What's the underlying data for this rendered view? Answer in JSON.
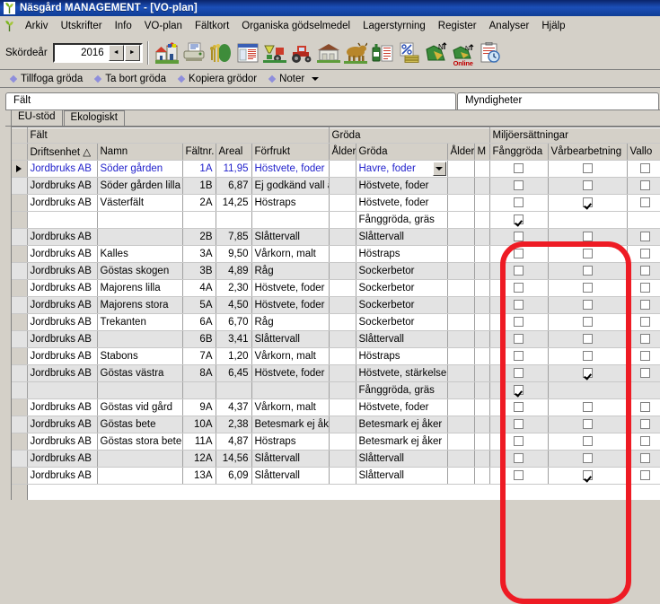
{
  "window": {
    "title": "Näsgård MANAGEMENT - [VO-plan]",
    "logo_icon": "leaf-icon"
  },
  "menu": {
    "items": [
      {
        "label": "Arkiv"
      },
      {
        "label": "Utskrifter"
      },
      {
        "label": "Info"
      },
      {
        "label": "VO-plan"
      },
      {
        "label": "Fältkort"
      },
      {
        "label": "Organiska gödselmedel"
      },
      {
        "label": "Lagerstyrning"
      },
      {
        "label": "Register"
      },
      {
        "label": "Analyser"
      },
      {
        "label": "Hjälp"
      }
    ]
  },
  "toolbar": {
    "year_label": "Skördeår",
    "year_value": "2016",
    "spin_down": "◄",
    "spin_up": "►",
    "online_label": "Online",
    "icons": [
      "farm-house-icon",
      "printer-icon",
      "crop-field-icon",
      "field-register-icon",
      "spreader-tractor-icon",
      "tractor-icon",
      "barn-icon",
      "cattle-icon",
      "fertilizer-bottle-icon",
      "percent-calc-icon",
      "nitrogen-map-icon",
      "nitrogen-map-online-icon",
      "clipboard-clock-icon"
    ]
  },
  "actionbar": {
    "items": [
      {
        "label": "Tillfoga gröda",
        "icon": "diamond-bullet-icon"
      },
      {
        "label": "Ta bort gröda",
        "icon": "diamond-bullet-icon"
      },
      {
        "label": "Kopiera grödor",
        "icon": "diamond-bullet-icon"
      },
      {
        "label": "Noter",
        "icon": "diamond-bullet-icon",
        "has_caret": true
      }
    ]
  },
  "panel_tabs": {
    "left_tab": "Fält",
    "right_tab": "Myndigheter"
  },
  "sub_tabs": [
    {
      "label": "EU-stöd",
      "active": true
    },
    {
      "label": "Ekologiskt",
      "active": false
    }
  ],
  "grid": {
    "group_headers": [
      {
        "label": "",
        "key": "marker"
      },
      {
        "label": "Fält",
        "key": "falt"
      },
      {
        "label": "Gröda",
        "key": "groda"
      },
      {
        "label": "Miljöersättningar",
        "key": "miljo"
      }
    ],
    "columns": [
      {
        "label": "",
        "key": "marker"
      },
      {
        "label": "Driftsenhet △",
        "key": "driftsenhet"
      },
      {
        "label": "Namn",
        "key": "namn"
      },
      {
        "label": "Fältnr.",
        "key": "faltnr"
      },
      {
        "label": "Areal",
        "key": "areal"
      },
      {
        "label": "Förfrukt",
        "key": "forfrukt"
      },
      {
        "label": "Ålder",
        "key": "alder1"
      },
      {
        "label": "Gröda",
        "key": "groda"
      },
      {
        "label": "Ålder",
        "key": "alder2"
      },
      {
        "label": "M",
        "key": "m"
      },
      {
        "label": "Fånggröda",
        "key": "fanggroda"
      },
      {
        "label": "Vårbearbetning",
        "key": "varbearbetning"
      },
      {
        "label": "Vallo",
        "key": "vallo"
      }
    ],
    "rows": [
      {
        "marker": true,
        "current": true,
        "alt": false,
        "driftsenhet": "Jordbruks AB",
        "namn": "Söder gården",
        "faltnr": "1A",
        "areal": "11,95",
        "forfrukt": "Höstvete, foder",
        "alder1": "",
        "groda": "Havre, foder",
        "editing": true,
        "alder2": "",
        "m": "",
        "fanggroda": false,
        "varbearbetning": false,
        "vallo": false
      },
      {
        "marker": false,
        "current": false,
        "alt": true,
        "driftsenhet": "Jordbruks AB",
        "namn": "Söder gården lilla",
        "faltnr": "1B",
        "areal": "6,87",
        "forfrukt": "Ej godkänd vall åker",
        "alder1": "",
        "groda": "Höstvete, foder",
        "editing": false,
        "alder2": "",
        "m": "",
        "fanggroda": false,
        "varbearbetning": false,
        "vallo": false
      },
      {
        "marker": false,
        "current": false,
        "alt": false,
        "driftsenhet": "Jordbruks AB",
        "namn": "Västerfält",
        "faltnr": "2A",
        "areal": "14,25",
        "forfrukt": "Höstraps",
        "alder1": "",
        "groda": "Höstvete, foder",
        "editing": false,
        "alder2": "",
        "m": "",
        "fanggroda": false,
        "varbearbetning": true,
        "vallo": false
      },
      {
        "marker": false,
        "current": false,
        "alt": false,
        "continuation": true,
        "driftsenhet": "",
        "namn": "",
        "faltnr": "",
        "areal": "",
        "forfrukt": "",
        "alder1": "",
        "groda": "Fånggröda, gräs",
        "editing": false,
        "alder2": "",
        "m": "",
        "fanggroda": true,
        "varbearbetning": null,
        "vallo": null
      },
      {
        "marker": false,
        "current": false,
        "alt": true,
        "driftsenhet": "Jordbruks AB",
        "namn": "",
        "faltnr": "2B",
        "areal": "7,85",
        "forfrukt": "Slåttervall",
        "alder1": "",
        "groda": "Slåttervall",
        "editing": false,
        "alder2": "",
        "m": "",
        "fanggroda": false,
        "varbearbetning": false,
        "vallo": false
      },
      {
        "marker": false,
        "current": false,
        "alt": false,
        "driftsenhet": "Jordbruks AB",
        "namn": "Kalles",
        "faltnr": "3A",
        "areal": "9,50",
        "forfrukt": "Vårkorn, malt",
        "alder1": "",
        "groda": "Höstraps",
        "editing": false,
        "alder2": "",
        "m": "",
        "fanggroda": false,
        "varbearbetning": false,
        "vallo": false
      },
      {
        "marker": false,
        "current": false,
        "alt": true,
        "driftsenhet": "Jordbruks AB",
        "namn": "Göstas skogen",
        "faltnr": "3B",
        "areal": "4,89",
        "forfrukt": "Råg",
        "alder1": "",
        "groda": "Sockerbetor",
        "editing": false,
        "alder2": "",
        "m": "",
        "fanggroda": false,
        "varbearbetning": false,
        "vallo": false
      },
      {
        "marker": false,
        "current": false,
        "alt": false,
        "driftsenhet": "Jordbruks AB",
        "namn": "Majorens lilla",
        "faltnr": "4A",
        "areal": "2,30",
        "forfrukt": "Höstvete, foder",
        "alder1": "",
        "groda": "Sockerbetor",
        "editing": false,
        "alder2": "",
        "m": "",
        "fanggroda": false,
        "varbearbetning": false,
        "vallo": false
      },
      {
        "marker": false,
        "current": false,
        "alt": true,
        "driftsenhet": "Jordbruks AB",
        "namn": "Majorens stora",
        "faltnr": "5A",
        "areal": "4,50",
        "forfrukt": "Höstvete, foder",
        "alder1": "",
        "groda": "Sockerbetor",
        "editing": false,
        "alder2": "",
        "m": "",
        "fanggroda": false,
        "varbearbetning": false,
        "vallo": false
      },
      {
        "marker": false,
        "current": false,
        "alt": false,
        "driftsenhet": "Jordbruks AB",
        "namn": "Trekanten",
        "faltnr": "6A",
        "areal": "6,70",
        "forfrukt": "Råg",
        "alder1": "",
        "groda": "Sockerbetor",
        "editing": false,
        "alder2": "",
        "m": "",
        "fanggroda": false,
        "varbearbetning": false,
        "vallo": false
      },
      {
        "marker": false,
        "current": false,
        "alt": true,
        "driftsenhet": "Jordbruks AB",
        "namn": "",
        "faltnr": "6B",
        "areal": "3,41",
        "forfrukt": "Slåttervall",
        "alder1": "",
        "groda": "Slåttervall",
        "editing": false,
        "alder2": "",
        "m": "",
        "fanggroda": false,
        "varbearbetning": false,
        "vallo": false
      },
      {
        "marker": false,
        "current": false,
        "alt": false,
        "driftsenhet": "Jordbruks AB",
        "namn": "Stabons",
        "faltnr": "7A",
        "areal": "1,20",
        "forfrukt": "Vårkorn, malt",
        "alder1": "",
        "groda": "Höstraps",
        "editing": false,
        "alder2": "",
        "m": "",
        "fanggroda": false,
        "varbearbetning": false,
        "vallo": false
      },
      {
        "marker": false,
        "current": false,
        "alt": true,
        "driftsenhet": "Jordbruks AB",
        "namn": "Göstas västra",
        "faltnr": "8A",
        "areal": "6,45",
        "forfrukt": "Höstvete, foder",
        "alder1": "",
        "groda": "Höstvete, stärkelse",
        "editing": false,
        "alder2": "",
        "m": "",
        "fanggroda": false,
        "varbearbetning": true,
        "vallo": false
      },
      {
        "marker": false,
        "current": false,
        "alt": true,
        "continuation": true,
        "driftsenhet": "",
        "namn": "",
        "faltnr": "",
        "areal": "",
        "forfrukt": "",
        "alder1": "",
        "groda": "Fånggröda, gräs",
        "editing": false,
        "alder2": "",
        "m": "",
        "fanggroda": true,
        "varbearbetning": null,
        "vallo": null
      },
      {
        "marker": false,
        "current": false,
        "alt": false,
        "driftsenhet": "Jordbruks AB",
        "namn": "Göstas vid gård",
        "faltnr": "9A",
        "areal": "4,37",
        "forfrukt": "Vårkorn, malt",
        "alder1": "",
        "groda": "Höstvete, foder",
        "editing": false,
        "alder2": "",
        "m": "",
        "fanggroda": false,
        "varbearbetning": false,
        "vallo": false
      },
      {
        "marker": false,
        "current": false,
        "alt": true,
        "driftsenhet": "Jordbruks AB",
        "namn": "Göstas bete",
        "faltnr": "10A",
        "areal": "2,38",
        "forfrukt": "Betesmark ej åker",
        "alder1": "",
        "groda": "Betesmark ej åker",
        "editing": false,
        "alder2": "",
        "m": "",
        "fanggroda": false,
        "varbearbetning": false,
        "vallo": false
      },
      {
        "marker": false,
        "current": false,
        "alt": false,
        "driftsenhet": "Jordbruks AB",
        "namn": "Göstas stora bete",
        "faltnr": "11A",
        "areal": "4,87",
        "forfrukt": "Höstraps",
        "alder1": "",
        "groda": "Betesmark ej åker",
        "editing": false,
        "alder2": "",
        "m": "",
        "fanggroda": false,
        "varbearbetning": false,
        "vallo": false
      },
      {
        "marker": false,
        "current": false,
        "alt": true,
        "driftsenhet": "Jordbruks AB",
        "namn": "",
        "faltnr": "12A",
        "areal": "14,56",
        "forfrukt": "Slåttervall",
        "alder1": "",
        "groda": "Slåttervall",
        "editing": false,
        "alder2": "",
        "m": "",
        "fanggroda": false,
        "varbearbetning": false,
        "vallo": false
      },
      {
        "marker": false,
        "current": false,
        "alt": false,
        "driftsenhet": "Jordbruks AB",
        "namn": "",
        "faltnr": "13A",
        "areal": "6,09",
        "forfrukt": "Slåttervall",
        "alder1": "",
        "groda": "Slåttervall",
        "editing": false,
        "alder2": "",
        "m": "",
        "fanggroda": false,
        "varbearbetning": true,
        "vallo": false
      }
    ]
  },
  "annotation": {
    "highlight_color": "#ee1b24",
    "highlight_target": "Miljöersättningar"
  }
}
